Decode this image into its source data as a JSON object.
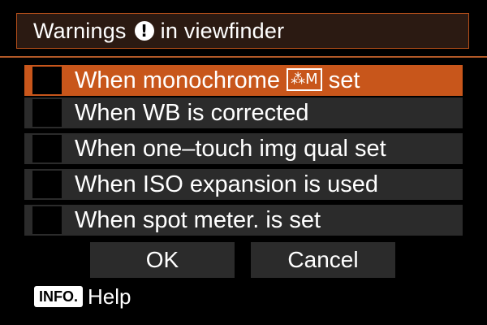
{
  "title": {
    "before": "Warnings",
    "icon": "!",
    "after": "in viewfinder"
  },
  "options": [
    {
      "label_before": "When monochrome",
      "icon": "⁂M",
      "label_after": "set",
      "selected": true
    },
    {
      "label": "When WB is corrected",
      "selected": false
    },
    {
      "label": "When one–touch img qual set",
      "selected": false
    },
    {
      "label": "When ISO expansion is used",
      "selected": false
    },
    {
      "label": "When spot meter. is set",
      "selected": false
    }
  ],
  "buttons": {
    "ok": "OK",
    "cancel": "Cancel"
  },
  "help": {
    "badge": "INFO.",
    "text": "Help"
  },
  "colors": {
    "selected": "#c8561b",
    "row": "#2b2b2b",
    "accent": "#b45a28"
  }
}
